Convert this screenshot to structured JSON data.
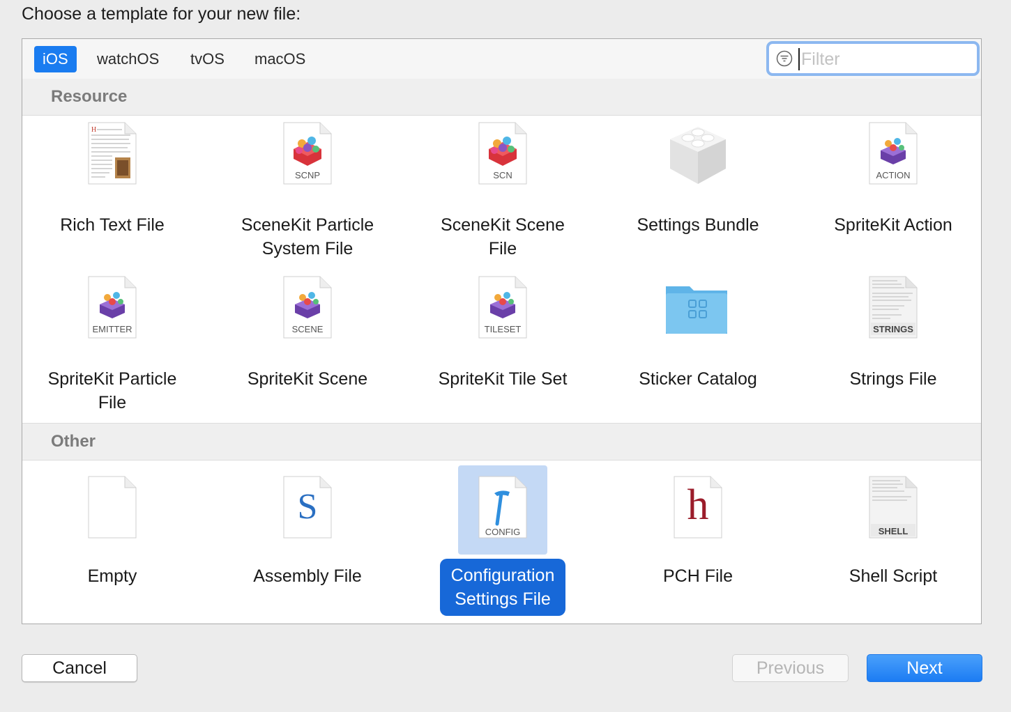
{
  "dialog": {
    "title": "Choose a template for your new file:"
  },
  "tabs": [
    {
      "label": "iOS",
      "active": true
    },
    {
      "label": "watchOS",
      "active": false
    },
    {
      "label": "tvOS",
      "active": false
    },
    {
      "label": "macOS",
      "active": false
    }
  ],
  "filter": {
    "placeholder": "Filter",
    "value": ""
  },
  "sections": [
    {
      "title": "Resource",
      "items": [
        {
          "label": "Rich Text File",
          "icon": "rich-text-file-icon"
        },
        {
          "label": "SceneKit Particle\nSystem File",
          "icon": "scenekit-particle-icon",
          "badge": "SCNP"
        },
        {
          "label": "SceneKit Scene\nFile",
          "icon": "scenekit-scene-icon",
          "badge": "SCN"
        },
        {
          "label": "Settings Bundle",
          "icon": "settings-bundle-icon"
        },
        {
          "label": "SpriteKit Action",
          "icon": "spritekit-action-icon",
          "badge": "ACTION"
        },
        {
          "label": "SpriteKit Particle\nFile",
          "icon": "spritekit-particle-icon",
          "badge": "EMITTER"
        },
        {
          "label": "SpriteKit Scene",
          "icon": "spritekit-scene-icon",
          "badge": "SCENE"
        },
        {
          "label": "SpriteKit Tile Set",
          "icon": "spritekit-tileset-icon",
          "badge": "TILESET"
        },
        {
          "label": "Sticker Catalog",
          "icon": "sticker-catalog-folder-icon"
        },
        {
          "label": "Strings File",
          "icon": "strings-file-icon",
          "badge": "STRINGS"
        }
      ]
    },
    {
      "title": "Other",
      "items": [
        {
          "label": "Empty",
          "icon": "empty-file-icon"
        },
        {
          "label": "Assembly File",
          "icon": "assembly-file-icon",
          "glyph": "S"
        },
        {
          "label": "Configuration\nSettings File",
          "icon": "config-file-icon",
          "badge": "CONFIG",
          "selected": true
        },
        {
          "label": "PCH File",
          "icon": "pch-file-icon",
          "glyph": "h"
        },
        {
          "label": "Shell Script",
          "icon": "shell-script-icon",
          "badge": "SHELL"
        }
      ]
    }
  ],
  "buttons": {
    "cancel": "Cancel",
    "previous": "Previous",
    "next": "Next"
  },
  "colors": {
    "accent": "#1a7cf0",
    "selection_bg": "#c4d9f5",
    "selected_label_bg": "#1768d8"
  }
}
